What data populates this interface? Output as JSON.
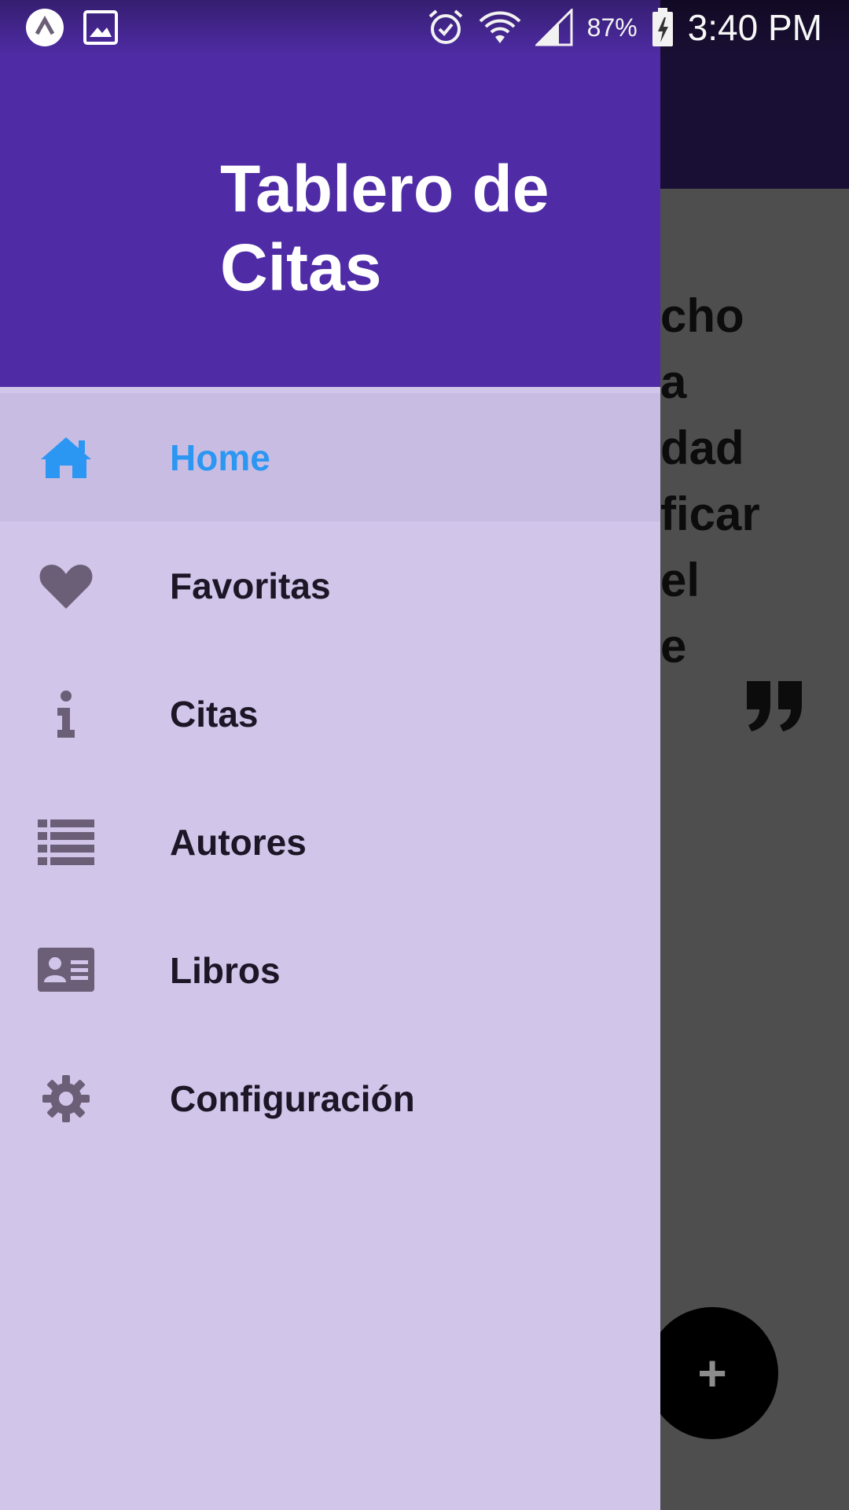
{
  "status_bar": {
    "battery": "87%",
    "time": "3:40 PM"
  },
  "drawer": {
    "title": "Tablero de Citas",
    "items": [
      {
        "label": "Home",
        "icon": "home-icon",
        "active": true
      },
      {
        "label": "Favoritas",
        "icon": "heart-icon",
        "active": false
      },
      {
        "label": "Citas",
        "icon": "info-icon",
        "active": false
      },
      {
        "label": "Autores",
        "icon": "list-icon",
        "active": false
      },
      {
        "label": "Libros",
        "icon": "id-card-icon",
        "active": false
      },
      {
        "label": "Configuración",
        "icon": "gear-icon",
        "active": false
      }
    ]
  },
  "background": {
    "quote_visible_text": "cho\na\ndad\nficar\nel\ne",
    "fab_label": "+"
  },
  "colors": {
    "header": "#4f2ca6",
    "drawer": "#d1c5e9",
    "active_item": "#c9bce2",
    "active_text": "#2b97f3",
    "icon": "#6b5f78"
  }
}
